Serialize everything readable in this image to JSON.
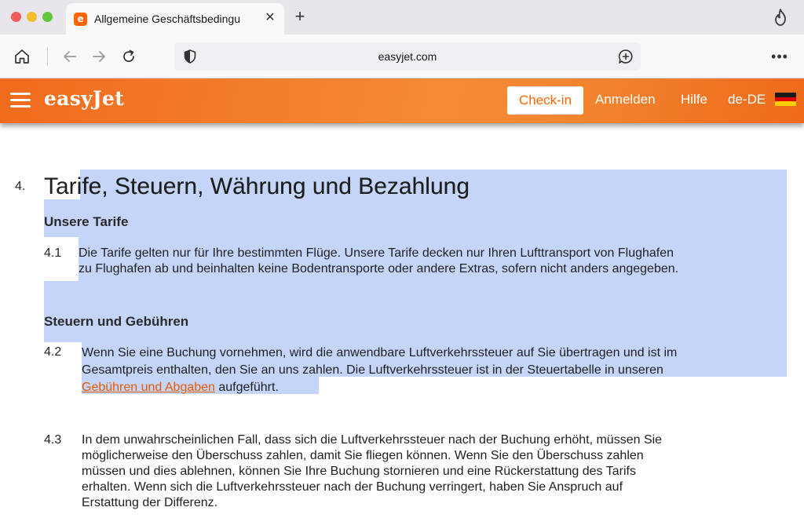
{
  "browser": {
    "tab_title": "Allgemeine Geschäftsbedingu",
    "tab_favicon_letter": "e",
    "tab_close": "✕",
    "new_tab": "+",
    "url": "easyjet.com",
    "menu": "•••"
  },
  "header": {
    "logo": "easyJet",
    "checkin_label": "Check-in",
    "login_label": "Anmelden",
    "help_label": "Hilfe",
    "language_label": "de-DE",
    "brand_color": "#ff6600"
  },
  "section": {
    "number": "4.",
    "title": "Tarife, Steuern, Währung und Bezahlung",
    "sub1": "Unsere Tarife",
    "sub2": "Steuern und Gebühren",
    "p41": {
      "number": "4.1",
      "lines": [
        "Die Tarife gelten nur für Ihre bestimmten Flüge. Unsere Tarife decken nur Ihren Lufttransport von Flughafen",
        "zu Flughafen ab und beinhalten keine Bodentransporte oder andere Extras, sofern nicht anders angegeben."
      ]
    },
    "p42": {
      "number": "4.2",
      "line1": "Wenn Sie eine Buchung vornehmen, wird die anwendbare Luftverkehrssteuer auf Sie übertragen und ist im",
      "line2": "Gesamtpreis enthalten, den Sie an uns zahlen. Die Luftverkehrssteuer ist in der Steuertabelle in unseren",
      "link": "Gebühren und Abgaben",
      "after_link": " aufgeführt."
    },
    "p43": {
      "number": "4.3",
      "lines": [
        "In dem unwahrscheinlichen Fall, dass sich die Luftverkehrssteuer nach der Buchung erhöht, müssen Sie",
        "möglicherweise den Überschuss zahlen, damit Sie fliegen können. Wenn Sie den Überschuss zahlen",
        "müssen und dies ablehnen, können Sie Ihre Buchung stornieren und eine Rückerstattung des Tarifs",
        "erhalten. Wenn sich die Luftverkehrssteuer nach der Buchung verringert, haben Sie Anspruch auf",
        "Erstattung der Differenz."
      ]
    }
  }
}
